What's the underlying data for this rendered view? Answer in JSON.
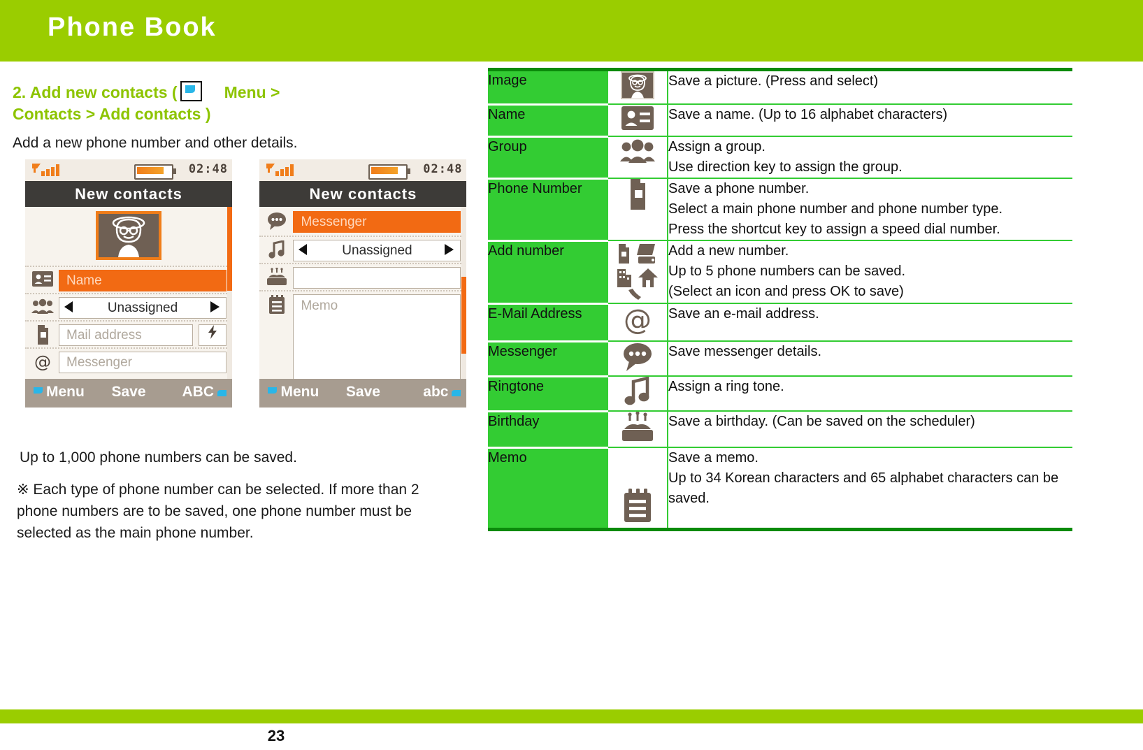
{
  "header": {
    "title": "Phone Book"
  },
  "left": {
    "section_title_a": "2. Add new contacts (",
    "section_title_b": "Menu >",
    "section_title_c": "Contacts > Add contacts )",
    "menu_icon": "menu-key-icon",
    "intro": "Add a new phone number and other details.",
    "note_capacity": "Up to 1,000 phone numbers can be saved.",
    "note_detail": "※ Each type of phone number can be selected. If more than 2 phone numbers are to be saved, one phone number must be selected as the main phone number."
  },
  "phone_screens": [
    {
      "status": {
        "signal": "signal-bars-icon",
        "battery": "battery-icon",
        "clock": "02:48"
      },
      "title": "New contacts",
      "fields": [
        {
          "icon": "avatar-photo-icon",
          "type": "avatar",
          "value": ""
        },
        {
          "icon": "name-card-icon",
          "type": "text",
          "value": "Name",
          "selected": true
        },
        {
          "icon": "group-people-icon",
          "type": "stepper",
          "value": "Unassigned"
        },
        {
          "icon": "mobile-phone-icon",
          "type": "text",
          "value": "Mail address",
          "extra_icon": "bolt-icon"
        },
        {
          "icon": "at-sign-icon",
          "type": "text",
          "value": "Messenger"
        }
      ],
      "softkeys": {
        "left": "Menu",
        "center": "Save",
        "right": "ABC"
      }
    },
    {
      "status": {
        "signal": "signal-bars-icon",
        "battery": "battery-icon",
        "clock": "02:48"
      },
      "title": "New contacts",
      "fields": [
        {
          "icon": "messenger-bubble-icon",
          "type": "text",
          "value": "Messenger",
          "selected": true
        },
        {
          "icon": "music-note-icon",
          "type": "stepper",
          "value": "Unassigned"
        },
        {
          "icon": "birthday-cake-icon",
          "type": "text",
          "value": ""
        },
        {
          "icon": "memo-note-icon",
          "type": "memo",
          "value": "Memo"
        }
      ],
      "softkeys": {
        "left": "Menu",
        "center": "Save",
        "right": "abc"
      }
    }
  ],
  "table": {
    "rows": [
      {
        "label": "Image",
        "icon": "avatar-photo-icon",
        "desc": [
          "Save a picture. (Press and select)"
        ]
      },
      {
        "label": "Name",
        "icon": "name-card-icon",
        "desc": [
          "Save a name. (Up to 16 alphabet characters)"
        ]
      },
      {
        "label": "Group",
        "icon": "group-people-icon",
        "desc": [
          "Assign a group.",
          "Use direction key  to assign  the group."
        ]
      },
      {
        "label": "Phone Number",
        "icon": "mobile-phone-icon",
        "desc": [
          "Save a phone number.",
          "Select a main phone number and phone number type.",
          "Press the shortcut key to assign a speed dial number."
        ]
      },
      {
        "label": "Add number",
        "icon": "number-types-icon",
        "desc": [
          "Add a new number.",
          "Up to 5 phone numbers can be saved.",
          "(Select an icon and press OK to save)"
        ]
      },
      {
        "label": "E-Mail Address",
        "icon": "at-sign-icon",
        "desc": [
          "Save an e-mail address."
        ]
      },
      {
        "label": "Messenger",
        "icon": "messenger-bubble-icon",
        "desc": [
          "Save messenger details."
        ]
      },
      {
        "label": "Ringtone",
        "icon": "music-note-icon",
        "desc": [
          "Assign a ring tone."
        ]
      },
      {
        "label": "Birthday",
        "icon": "birthday-cake-icon",
        "desc": [
          "Save a birthday. (Can be saved on the scheduler)"
        ]
      },
      {
        "label": "Memo",
        "icon": "memo-note-icon",
        "desc": [
          "Save a memo.",
          "Up to 34 Korean characters and 65 alphabet characters can be saved."
        ]
      }
    ]
  },
  "footer": {
    "page_number": "23"
  },
  "colors": {
    "header_green": "#9ACD00",
    "title_green": "#8DC400",
    "table_green": "#33CC33",
    "table_border_dark": "#0B8A0B",
    "phone_accent_orange": "#F26A13",
    "phone_icon_brown": "#6F6054"
  }
}
